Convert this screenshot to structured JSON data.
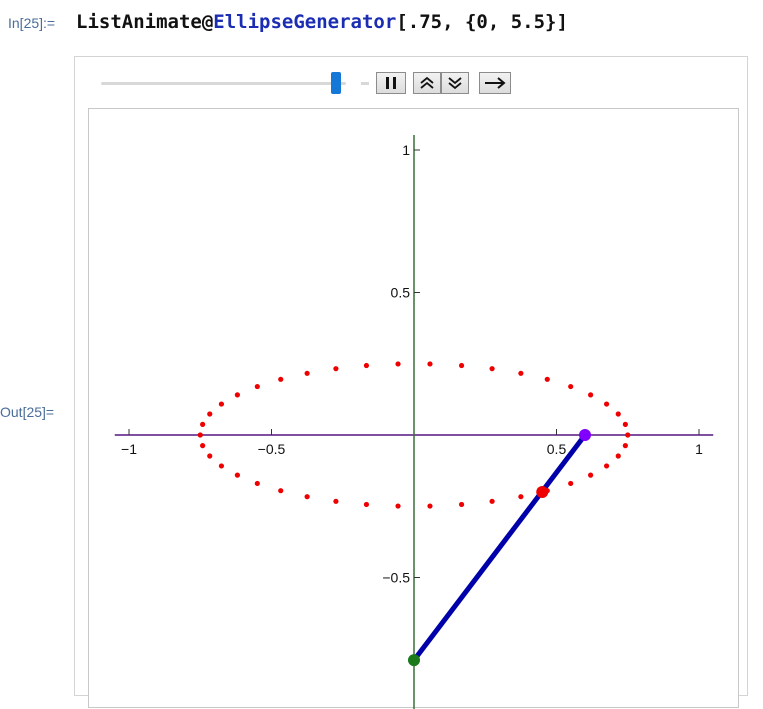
{
  "cell": {
    "in_label": "In[25]:=",
    "out_label": "Out[25]=",
    "input_parts": [
      "ListAnimate@",
      "EllipseGenerator",
      "[.75, {0, 5.5}]"
    ]
  },
  "controls": {
    "slider_position": 0.92,
    "pause_icon": "pause-icon",
    "faster_icon": "double-chevron-up-icon",
    "slower_icon": "double-chevron-down-icon",
    "direction_icon": "right-arrow-icon"
  },
  "chart_data": {
    "type": "scatter",
    "xlim": [
      -1,
      1
    ],
    "ylim": [
      -0.75,
      1
    ],
    "x_ticks": [
      {
        "value": -1,
        "label": "−1"
      },
      {
        "value": -0.5,
        "label": "−0.5"
      },
      {
        "value": 0.5,
        "label": "0.5"
      },
      {
        "value": 1,
        "label": "1"
      }
    ],
    "y_ticks": [
      {
        "value": 1,
        "label": "1"
      },
      {
        "value": 0.5,
        "label": "0.5"
      },
      {
        "value": -0.5,
        "label": "−0.5"
      }
    ],
    "ellipse": {
      "a": 0.75,
      "b": 0.25,
      "point_count": 42,
      "color": "#ee0000"
    },
    "segment": {
      "x1": 0.6,
      "y1": 0,
      "x2": 0,
      "y2": -0.79,
      "color": "#0000aa"
    },
    "points": [
      {
        "x": 0.6,
        "y": 0,
        "color": "#8000ff"
      },
      {
        "x": 0.45,
        "y": -0.2,
        "color": "#ee0000"
      },
      {
        "x": 0,
        "y": -0.79,
        "color": "#1a7a1a"
      }
    ],
    "x_axis_color": "#8050a0",
    "y_axis_color": "#3a6e3a",
    "grid": false
  }
}
